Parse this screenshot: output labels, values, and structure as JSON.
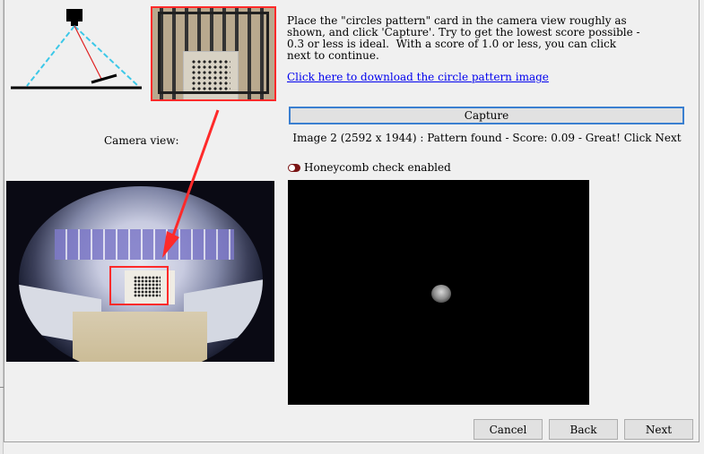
{
  "reference": {
    "camera_view_label": "Camera view:"
  },
  "instructions": {
    "text": "Place the \"circles pattern\" card in the camera view roughly as\nshown, and click 'Capture'. Try to get the lowest score possible -\n0.3 or less is ideal.  With a score of 1.0 or less, you can click\nnext to continue.",
    "download_link": "Click here to download the circle pattern image"
  },
  "capture": {
    "button_label": "Capture",
    "status": "Image 2 (2592 x 1944) : Pattern found - Score: 0.09 - Great! Click Next"
  },
  "honeycomb": {
    "label": "Honeycomb check enabled",
    "enabled": true
  },
  "colors": {
    "highlight": "#ff2a2a",
    "link": "#0000ee",
    "button_focus": "#3a7fd0"
  },
  "footer": {
    "cancel_label": "Cancel",
    "back_label": "Back",
    "next_label": "Next"
  }
}
